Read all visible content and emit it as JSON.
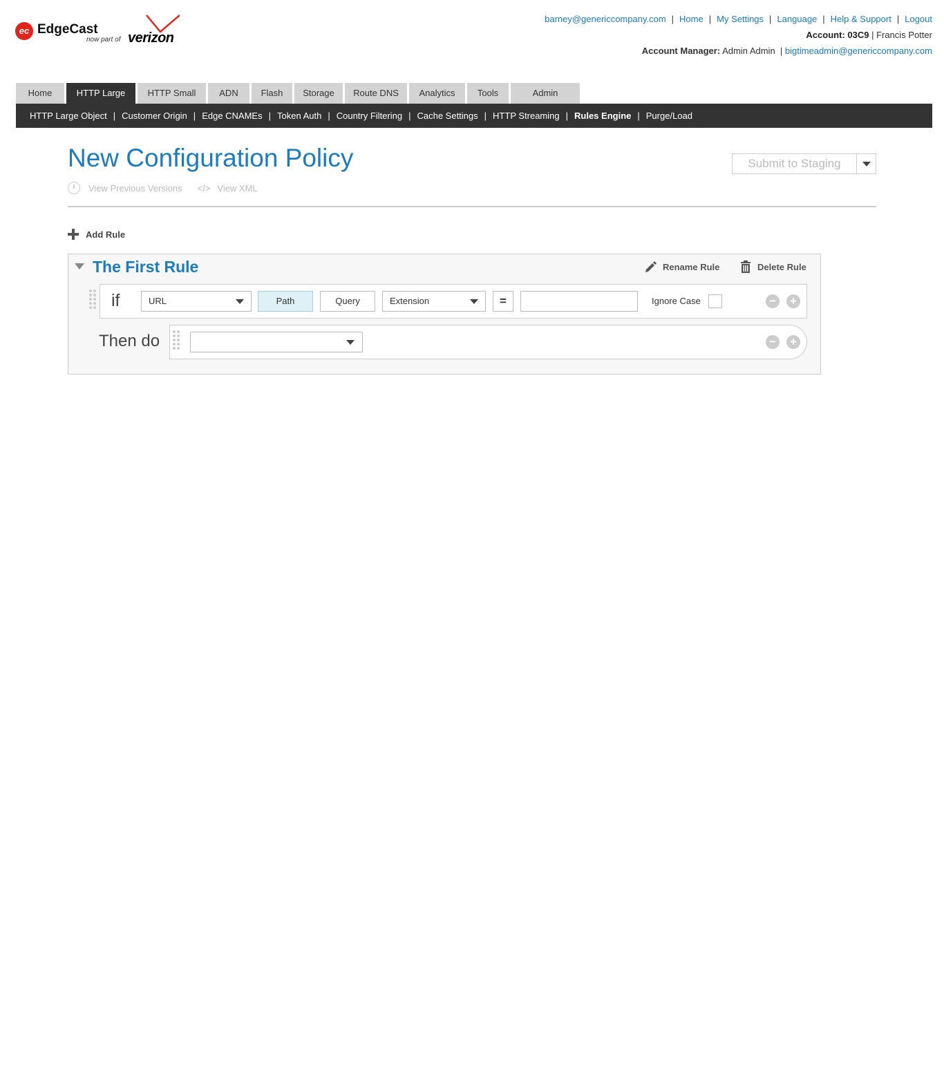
{
  "header": {
    "logo": {
      "brand": "EdgeCast",
      "mark": "ec",
      "tagline": "now part of",
      "partner": "verizon"
    },
    "top_links": [
      "barney@genericcompany.com",
      "Home",
      "My Settings",
      "Language",
      "Help & Support",
      "Logout"
    ],
    "account_label": "Account:",
    "account_id": "03C9",
    "account_user": "Francis Potter",
    "manager_label": "Account Manager:",
    "manager_name": "Admin Admin",
    "manager_email": "bigtimeadmin@genericcompany.com"
  },
  "main_tabs": [
    {
      "label": "Home",
      "active": false
    },
    {
      "label": "HTTP Large",
      "active": true
    },
    {
      "label": "HTTP Small",
      "active": false
    },
    {
      "label": "ADN",
      "active": false
    },
    {
      "label": "Flash",
      "active": false
    },
    {
      "label": "Storage",
      "active": false
    },
    {
      "label": "Route DNS",
      "active": false
    },
    {
      "label": "Analytics",
      "active": false
    },
    {
      "label": "Tools",
      "active": false
    },
    {
      "label": "Admin",
      "active": false
    }
  ],
  "sub_nav": [
    {
      "label": "HTTP Large Object",
      "active": false
    },
    {
      "label": "Customer Origin",
      "active": false
    },
    {
      "label": "Edge CNAMEs",
      "active": false
    },
    {
      "label": "Token Auth",
      "active": false
    },
    {
      "label": "Country Filtering",
      "active": false
    },
    {
      "label": "Cache Settings",
      "active": false
    },
    {
      "label": "HTTP Streaming",
      "active": false
    },
    {
      "label": "Rules Engine",
      "active": true
    },
    {
      "label": "Purge/Load",
      "active": false
    }
  ],
  "page": {
    "title": "New Configuration Policy",
    "view_versions": "View Previous Versions",
    "view_xml_icon": "</>",
    "view_xml": "View XML",
    "submit_label": "Submit to Staging",
    "add_rule": "Add Rule"
  },
  "rule": {
    "name": "The First Rule",
    "rename": "Rename Rule",
    "delete": "Delete Rule",
    "if_label": "if",
    "condition": {
      "match_type": "URL",
      "path_btn": "Path",
      "query_btn": "Query",
      "field": "Extension",
      "operator": "=",
      "value": "",
      "ignore_case_label": "Ignore Case",
      "ignore_case_checked": false
    },
    "then_label": "Then do",
    "action_value": "",
    "minus": "−",
    "plus": "+"
  },
  "colors": {
    "link": "#1a7bbf",
    "nav_dark": "#333333",
    "tab_bg": "#d3d3d3",
    "brand_red": "#e2231a",
    "active_toggle": "#dff0f7"
  }
}
